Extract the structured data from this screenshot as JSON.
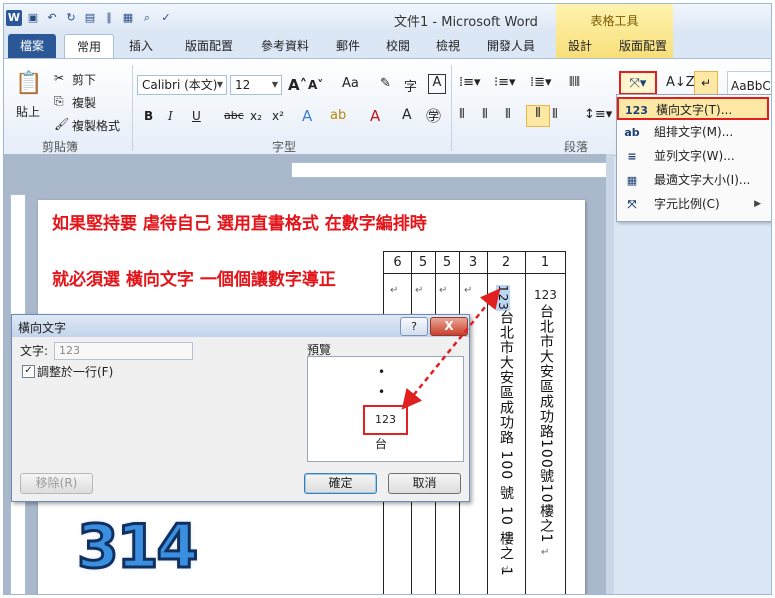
{
  "window": {
    "title": "文件1 - Microsoft Word",
    "context_tab_title": "表格工具"
  },
  "quick_access": {
    "app_icon": "W",
    "save_icon": "save-icon",
    "undo_icon": "undo-icon",
    "redo_icon": "redo-icon"
  },
  "tabs": {
    "file": "檔案",
    "home": "常用",
    "insert": "插入",
    "layout": "版面配置",
    "references": "參考資料",
    "mailings": "郵件",
    "review": "校閱",
    "view": "檢視",
    "developer": "開發人員",
    "design": "設計",
    "table_layout": "版面配置"
  },
  "clipboard": {
    "paste": "貼上",
    "cut": "剪下",
    "copy": "複製",
    "format_painter": "複製格式",
    "group_label": "剪貼簿"
  },
  "font": {
    "family": "Calibri (本文)",
    "size": "12",
    "group_label": "字型",
    "bold": "B",
    "italic": "I",
    "underline": "U",
    "strike": "abc",
    "subscript": "x₂",
    "superscript": "x²",
    "case": "Aa",
    "grow": "A",
    "shrink": "A"
  },
  "paragraph": {
    "group_label": "段落"
  },
  "text_direction_menu": {
    "items": [
      {
        "label": "橫向文字(T)...",
        "icon": "123"
      },
      {
        "label": "組排文字(M)...",
        "icon": "ab"
      },
      {
        "label": "並列文字(W)...",
        "icon": "≡"
      },
      {
        "label": "最適文字大小(I)...",
        "icon": "▦"
      },
      {
        "label": "字元比例(C)",
        "icon": "⤧"
      }
    ]
  },
  "styles": {
    "sample": "AaBbC"
  },
  "document": {
    "instruction_line1": "如果堅持要 虐待自己 選用直書格式 在數字編排時",
    "instruction_line2": "就必須選 橫向文字 一個個讓數字導正",
    "table_headers": [
      "6",
      "5",
      "5",
      "3",
      "2",
      "1"
    ],
    "col2_num": "123",
    "col2_text": "台北市大安區成功路 100 號 10 樓之 1",
    "col1_num": "123",
    "col1_text": "台北市大安區成功路100號10樓之1",
    "return_mark": "↵"
  },
  "dialog": {
    "title": "橫向文字",
    "text_label": "文字:",
    "text_value": "123",
    "fit_line_label": "調整於一行(F)",
    "fit_line_checked": "✓",
    "preview_label": "預覽",
    "preview_dot": "•",
    "preview_number": "123",
    "preview_char": "台",
    "remove_button": "移除(R)",
    "ok_button": "確定",
    "cancel_button": "取消",
    "help_glyph": "?",
    "close_glyph": "X"
  },
  "logo_text": "314"
}
